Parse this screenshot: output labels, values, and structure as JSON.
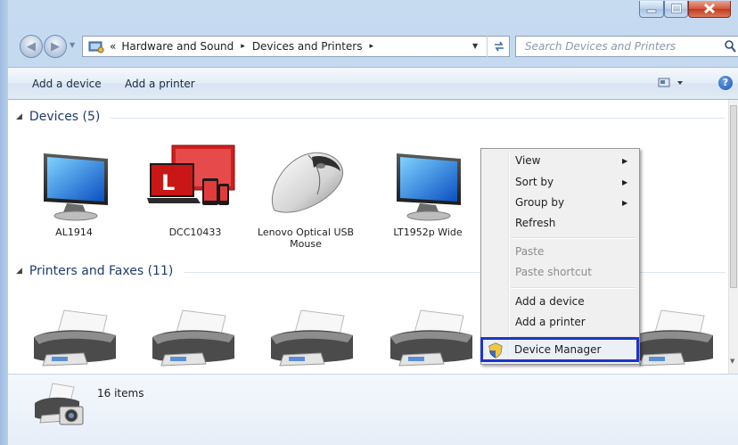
{
  "address": {
    "overflow_glyph": "«",
    "crumbs": [
      "Hardware and Sound",
      "Devices and Printers"
    ],
    "separator": "▸"
  },
  "search": {
    "placeholder": "Search Devices and Printers"
  },
  "toolbar": {
    "add_device": "Add a device",
    "add_printer": "Add a printer"
  },
  "groups": {
    "devices": {
      "label": "Devices (5)"
    },
    "printers": {
      "label": "Printers and Faxes (11)"
    }
  },
  "devices": [
    {
      "label": "AL1914",
      "icon": "monitor-icon"
    },
    {
      "label": "DCC10433",
      "icon": "computer-icon"
    },
    {
      "label": "Lenovo Optical USB Mouse",
      "icon": "mouse-icon"
    },
    {
      "label": "LT1952p Wide",
      "icon": "monitor-icon"
    }
  ],
  "context_menu": {
    "view": "View",
    "sort_by": "Sort by",
    "group_by": "Group by",
    "refresh": "Refresh",
    "paste": "Paste",
    "paste_shortcut": "Paste shortcut",
    "add_device": "Add a device",
    "add_printer": "Add a printer",
    "device_manager": "Device Manager"
  },
  "details": {
    "count": "16 items"
  },
  "colors": {
    "highlight_border": "#1d35c8",
    "group_header": "#1e3b6e"
  }
}
